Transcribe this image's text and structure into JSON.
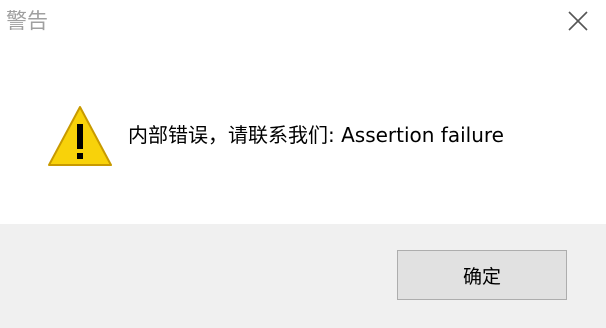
{
  "window": {
    "title": "警告",
    "close_icon": "close-icon"
  },
  "content": {
    "icon": "warning-icon",
    "message": "内部错误，请联系我们: Assertion failure"
  },
  "footer": {
    "ok_label": "确定"
  },
  "colors": {
    "footer_bg": "#f0f0f0",
    "warning_fill": "#f8d20a",
    "button_bg": "#e1e1e1"
  }
}
